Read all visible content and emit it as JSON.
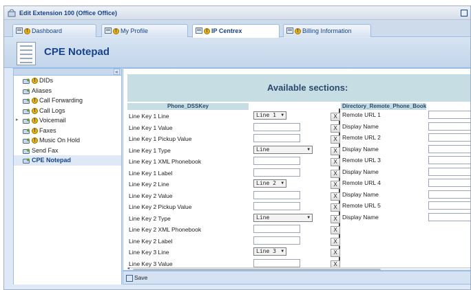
{
  "window": {
    "title": "Edit Extension 100 (Office Office)"
  },
  "tabs": [
    {
      "label": "Dashboard",
      "icon": "dashboard-icon"
    },
    {
      "label": "My Profile",
      "icon": "user-icon"
    },
    {
      "label": "IP Centrex",
      "icon": "phone-icon",
      "active": true
    },
    {
      "label": "Billing Information",
      "icon": "billing-icon"
    }
  ],
  "header": {
    "title": "CPE Notepad"
  },
  "sidebar": {
    "collapse_glyph": "«",
    "items": [
      {
        "label": "DIDs",
        "icon": "did-icon",
        "warning": true
      },
      {
        "label": "Aliases",
        "icon": "alias-icon",
        "warning": false
      },
      {
        "label": "Call Forwarding",
        "icon": "forward-icon",
        "warning": true
      },
      {
        "label": "Call Logs",
        "icon": "logs-icon",
        "warning": true
      },
      {
        "label": "Voicemail",
        "icon": "voicemail-icon",
        "warning": true,
        "expandable": true
      },
      {
        "label": "Faxes",
        "icon": "fax-icon",
        "warning": true
      },
      {
        "label": "Music On Hold",
        "icon": "music-icon",
        "warning": true
      },
      {
        "label": "Send Fax",
        "icon": "sendfax-icon",
        "warning": false
      },
      {
        "label": "CPE Notepad",
        "icon": "notepad-icon",
        "warning": false,
        "selected": true
      }
    ]
  },
  "main": {
    "available_title": "Available sections:",
    "left_column_header": "Phone_DSSKey",
    "right_column_header": "Directory_Remote_Phone_Book",
    "remove_label": "X",
    "left_rows": [
      {
        "label": "Line Key 1 Line",
        "control": "select",
        "value": "Line 1",
        "width": "short"
      },
      {
        "label": "Line Key 1 Value",
        "control": "text",
        "value": ""
      },
      {
        "label": "Line Key 1 Pickup Value",
        "control": "text",
        "value": ""
      },
      {
        "label": "Line Key 1 Type",
        "control": "select",
        "value": "Line",
        "width": "long"
      },
      {
        "label": "Line Key 1 XML Phonebook",
        "control": "text",
        "value": ""
      },
      {
        "label": "Line Key 1 Label",
        "control": "text",
        "value": ""
      },
      {
        "label": "Line Key 2 Line",
        "control": "select",
        "value": "Line 2",
        "width": "short"
      },
      {
        "label": "Line Key 2 Value",
        "control": "text",
        "value": ""
      },
      {
        "label": "Line Key 2 Pickup Value",
        "control": "text",
        "value": ""
      },
      {
        "label": "Line Key 2 Type",
        "control": "select",
        "value": "Line",
        "width": "long"
      },
      {
        "label": "Line Key 2 XML Phonebook",
        "control": "text",
        "value": ""
      },
      {
        "label": "Line Key 2 Label",
        "control": "text",
        "value": ""
      },
      {
        "label": "Line Key 3 Line",
        "control": "select",
        "value": "Line 3",
        "width": "short"
      },
      {
        "label": "Line Key 3 Value",
        "control": "text",
        "value": ""
      }
    ],
    "right_rows": [
      {
        "label": "Remote URL 1",
        "value": ""
      },
      {
        "label": "Display Name",
        "value": ""
      },
      {
        "label": "Remote URL 2",
        "value": ""
      },
      {
        "label": "Display Name",
        "value": ""
      },
      {
        "label": "Remote URL 3",
        "value": ""
      },
      {
        "label": "Display Name",
        "value": ""
      },
      {
        "label": "Remote URL 4",
        "value": ""
      },
      {
        "label": "Display Name",
        "value": ""
      },
      {
        "label": "Remote URL 5",
        "value": ""
      },
      {
        "label": "Display Name",
        "value": ""
      }
    ]
  },
  "footer": {
    "save_label": "Save"
  },
  "colors": {
    "accent": "#15428b",
    "panel": "#dfe8f6",
    "section": "#c7dde4",
    "warning": "#e8b400"
  }
}
